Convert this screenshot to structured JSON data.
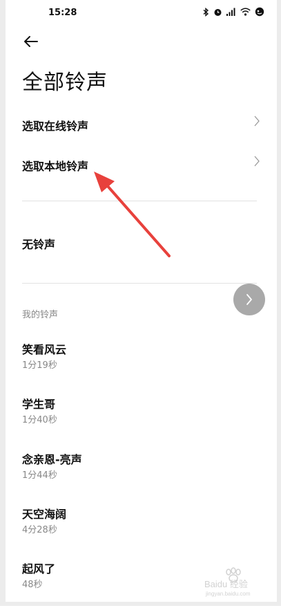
{
  "status": {
    "time": "15:28"
  },
  "page": {
    "title": "全部铃声"
  },
  "menu": {
    "online_label": "选取在线铃声",
    "local_label": "选取本地铃声",
    "none_label": "无铃声"
  },
  "section": {
    "my_ringtones": "我的铃声"
  },
  "ringtones": [
    {
      "title": "笑看风云",
      "duration": "1分19秒"
    },
    {
      "title": "学生哥",
      "duration": "1分40秒"
    },
    {
      "title": "念亲恩-亮声",
      "duration": "1分44秒"
    },
    {
      "title": "天空海阔",
      "duration": "4分28秒"
    },
    {
      "title": "起风了",
      "duration": "48秒"
    }
  ],
  "watermark": {
    "text": "Baidu 经验",
    "sub": "jingyan.baidu.com"
  },
  "colors": {
    "annotation_arrow": "#e8413c",
    "float_button": "#a9a9a9"
  }
}
